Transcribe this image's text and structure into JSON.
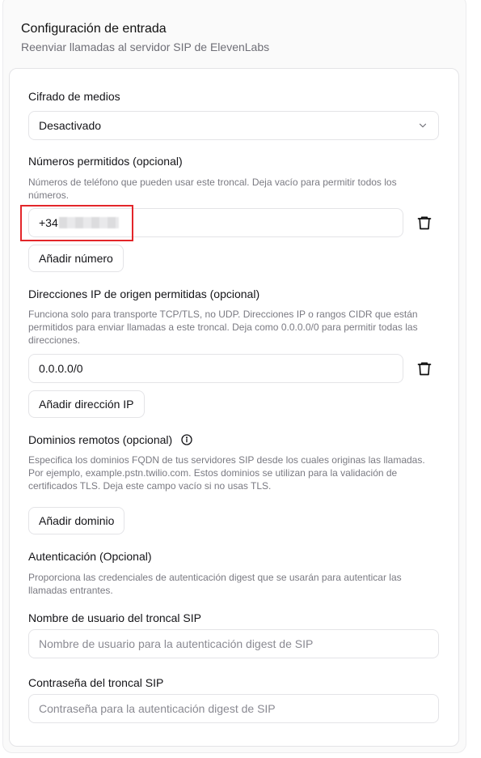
{
  "header": {
    "title": "Configuración de entrada",
    "subtitle": "Reenviar llamadas al servidor SIP de ElevenLabs"
  },
  "media_encryption": {
    "label": "Cifrado de medios",
    "selected": "Desactivado"
  },
  "allowed_numbers": {
    "label": "Números permitidos (opcional)",
    "help": "Números de teléfono que pueden usar este troncal. Deja vacío para permitir todos los números.",
    "value_prefix": "+34",
    "add_button": "Añadir número"
  },
  "allowed_ips": {
    "label": "Direcciones IP de origen permitidas (opcional)",
    "help": "Funciona solo para transporte TCP/TLS, no UDP. Direcciones IP o rangos CIDR que están permitidos para enviar llamadas a este troncal. Deja como 0.0.0.0/0 para permitir todas las direcciones.",
    "value": "0.0.0.0/0",
    "add_button": "Añadir dirección IP"
  },
  "remote_domains": {
    "label": "Dominios remotos (opcional)",
    "help": "Especifica los dominios FQDN de tus servidores SIP desde los cuales originas las llamadas. Por ejemplo, example.pstn.twilio.com. Estos dominios se utilizan para la validación de certificados TLS. Deja este campo vacío si no usas TLS.",
    "add_button": "Añadir dominio"
  },
  "authentication": {
    "label": "Autenticación (Opcional)",
    "help": "Proporciona las credenciales de autenticación digest que se usarán para autenticar las llamadas entrantes.",
    "username_label": "Nombre de usuario del troncal SIP",
    "username_placeholder": "Nombre de usuario para la autenticación digest de SIP",
    "password_label": "Contraseña del troncal SIP",
    "password_placeholder": "Contraseña para la autenticación digest de SIP"
  },
  "colors": {
    "highlight": "#e3262a",
    "border": "#e4e4e7",
    "muted_text": "#7a7a82"
  }
}
